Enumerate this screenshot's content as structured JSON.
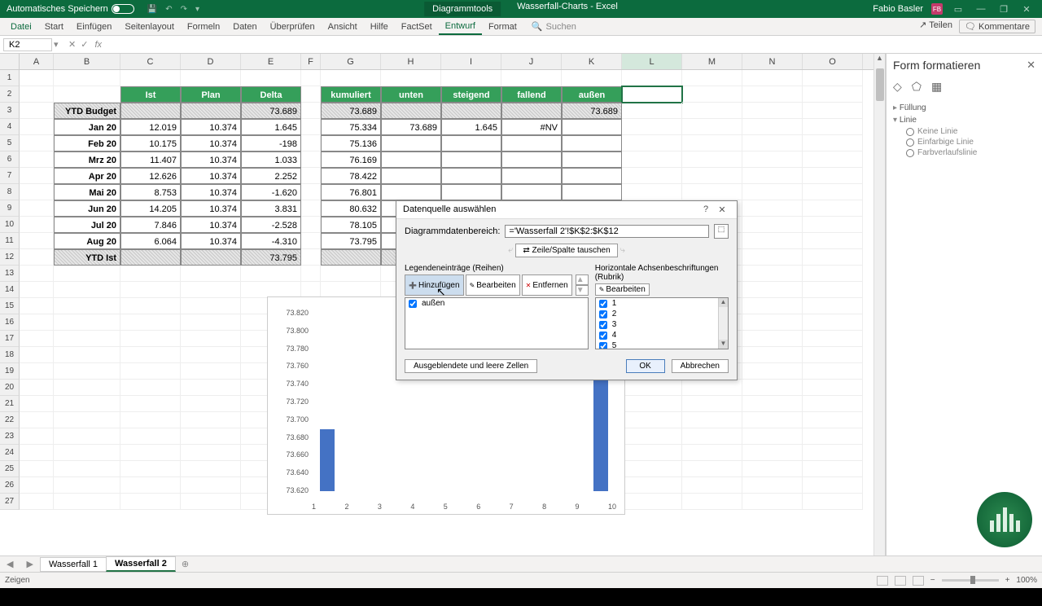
{
  "titlebar": {
    "autosave": "Automatisches Speichern",
    "tool_context": "Diagrammtools",
    "doc_title": "Wasserfall-Charts - Excel",
    "user_name": "Fabio Basler",
    "user_initials": "FB"
  },
  "ribbon": {
    "tabs": [
      "Datei",
      "Start",
      "Einfügen",
      "Seitenlayout",
      "Formeln",
      "Daten",
      "Überprüfen",
      "Ansicht",
      "Hilfe",
      "FactSet",
      "Entwurf",
      "Format"
    ],
    "active_index": 10,
    "search": "Suchen",
    "share": "Teilen",
    "comments": "Kommentare"
  },
  "fxbar": {
    "namebox": "K2",
    "formula": ""
  },
  "columns_visible": [
    "A",
    "B",
    "C",
    "D",
    "E",
    "F",
    "G",
    "H",
    "I",
    "J",
    "K",
    "L",
    "M",
    "N",
    "O"
  ],
  "selected_cell": "L2",
  "table1": {
    "headers": [
      "Ist",
      "Plan",
      "Delta"
    ],
    "rows": [
      {
        "label": "YTD Budget",
        "vals": [
          "",
          "",
          "73.689"
        ],
        "hatch": true
      },
      {
        "label": "Jan 20",
        "vals": [
          "12.019",
          "10.374",
          "1.645"
        ]
      },
      {
        "label": "Feb 20",
        "vals": [
          "10.175",
          "10.374",
          "-198"
        ]
      },
      {
        "label": "Mrz 20",
        "vals": [
          "11.407",
          "10.374",
          "1.033"
        ]
      },
      {
        "label": "Apr 20",
        "vals": [
          "12.626",
          "10.374",
          "2.252"
        ]
      },
      {
        "label": "Mai 20",
        "vals": [
          "8.753",
          "10.374",
          "-1.620"
        ]
      },
      {
        "label": "Jun 20",
        "vals": [
          "14.205",
          "10.374",
          "3.831"
        ]
      },
      {
        "label": "Jul 20",
        "vals": [
          "7.846",
          "10.374",
          "-2.528"
        ]
      },
      {
        "label": "Aug 20",
        "vals": [
          "6.064",
          "10.374",
          "-4.310"
        ]
      },
      {
        "label": "YTD Ist",
        "vals": [
          "",
          "",
          "73.795"
        ],
        "hatch": true
      }
    ]
  },
  "table2": {
    "headers": [
      "kumuliert",
      "unten",
      "steigend",
      "fallend",
      "außen"
    ],
    "rows": [
      [
        "73.689",
        "",
        "",
        "",
        "73.689"
      ],
      [
        "75.334",
        "73.689",
        "1.645",
        "#NV",
        ""
      ],
      [
        "75.136",
        "",
        "",
        "",
        ""
      ],
      [
        "76.169",
        "",
        "",
        "",
        ""
      ],
      [
        "78.422",
        "",
        "",
        "",
        ""
      ],
      [
        "76.801",
        "",
        "",
        "",
        ""
      ],
      [
        "80.632",
        "",
        "",
        "",
        ""
      ],
      [
        "78.105",
        "",
        "",
        "",
        ""
      ],
      [
        "73.795",
        "",
        "",
        "",
        ""
      ],
      [
        "",
        "",
        "",
        "",
        ""
      ]
    ],
    "row_hatch": [
      true,
      false,
      false,
      false,
      false,
      false,
      false,
      false,
      false,
      true
    ]
  },
  "chart_data": {
    "type": "bar",
    "categories": [
      "1",
      "2",
      "3",
      "4",
      "5",
      "6",
      "7",
      "8",
      "9",
      "10"
    ],
    "values": [
      73.689,
      null,
      null,
      null,
      null,
      null,
      null,
      null,
      null,
      73.795
    ],
    "ylim": [
      73.62,
      73.82
    ],
    "yticks": [
      "73.820",
      "73.800",
      "73.780",
      "73.760",
      "73.740",
      "73.720",
      "73.700",
      "73.680",
      "73.660",
      "73.640",
      "73.620"
    ],
    "xlabel": "",
    "ylabel": "",
    "title": ""
  },
  "dialog": {
    "title": "Datenquelle auswählen",
    "range_label": "Diagrammdatenbereich:",
    "range_value": "='Wasserfall 2'!$K$2:$K$12",
    "swap": "Zeile/Spalte tauschen",
    "legend_label": "Legendeneinträge (Reihen)",
    "axis_label": "Horizontale Achsenbeschriftungen (Rubrik)",
    "btn_add": "Hinzufügen",
    "btn_edit": "Bearbeiten",
    "btn_remove": "Entfernen",
    "btn_edit2": "Bearbeiten",
    "series": [
      "außen"
    ],
    "categories": [
      "1",
      "2",
      "3",
      "4",
      "5"
    ],
    "hidden_cells": "Ausgeblendete und leere Zellen",
    "ok": "OK",
    "cancel": "Abbrechen"
  },
  "taskpane": {
    "title": "Form formatieren",
    "sect_fill": "Füllung",
    "sect_line": "Linie",
    "opt_noline": "Keine Linie",
    "opt_solid": "Einfarbige Linie",
    "opt_gradient": "Farbverlaufslinie"
  },
  "sheettabs": {
    "tabs": [
      "Wasserfall 1",
      "Wasserfall 2"
    ],
    "active": 1
  },
  "statusbar": {
    "mode": "Zeigen",
    "zoom": "100%"
  }
}
